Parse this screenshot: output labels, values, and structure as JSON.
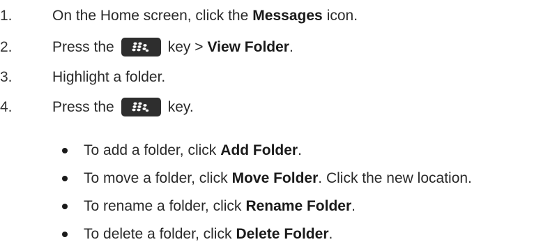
{
  "steps": [
    {
      "num": "1.",
      "pre": "On the Home screen, click the",
      "bold": "Messages",
      "post": "icon."
    },
    {
      "num": "2.",
      "pre": "Press the",
      "key_icon": "blackberry-menu-key-icon",
      "mid": "key >",
      "bold": "View Folder",
      "post": "."
    },
    {
      "num": "3.",
      "text": "Highlight a folder."
    },
    {
      "num": "4.",
      "pre": "Press the",
      "key_icon": "blackberry-menu-key-icon",
      "post": "key."
    }
  ],
  "bullets": [
    {
      "pre": "To add a folder, click",
      "bold": "Add Folder",
      "post": "."
    },
    {
      "pre": "To move a folder, click",
      "bold": "Move Folder",
      "post": ". Click the new location."
    },
    {
      "pre": "To rename a folder, click",
      "bold": "Rename Folder",
      "post": "."
    },
    {
      "pre": "To delete a folder, click",
      "bold": "Delete Folder",
      "post": "."
    }
  ],
  "colors": {
    "text": "#2a2a2a",
    "key_background": "#2e2e2e",
    "key_glyph": "#ffffff"
  }
}
